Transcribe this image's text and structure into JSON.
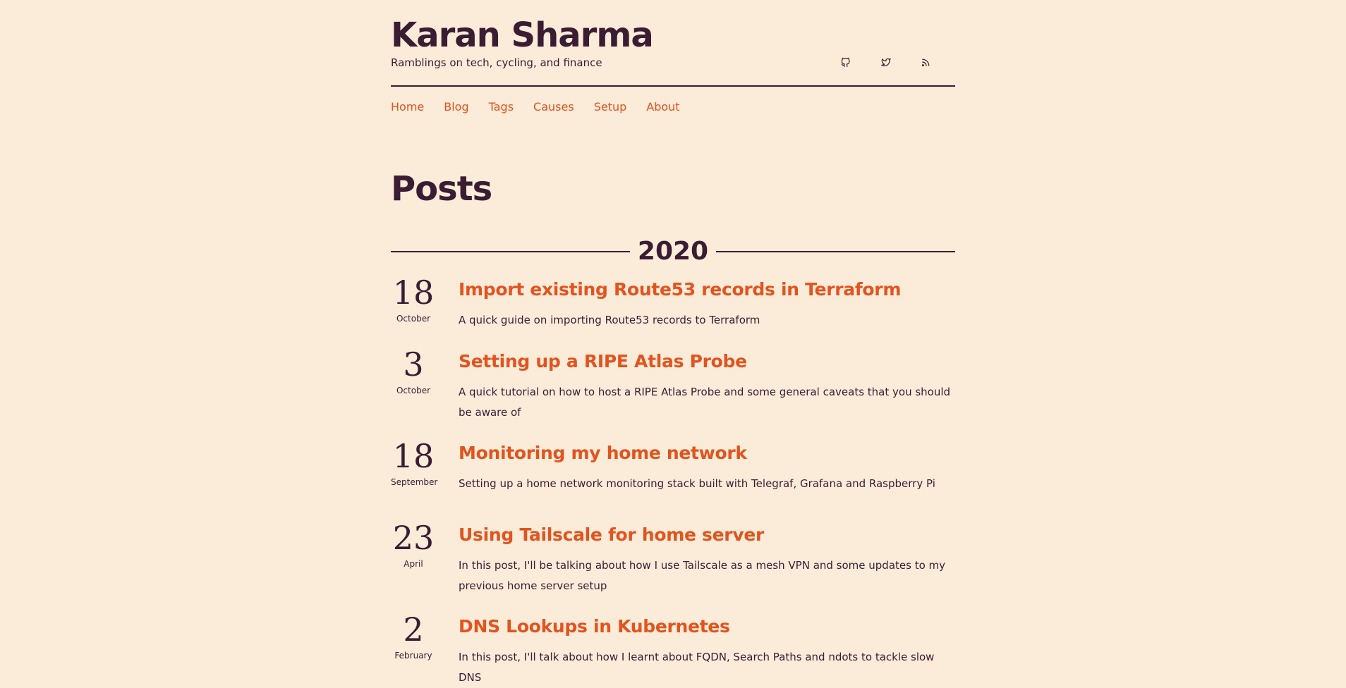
{
  "site": {
    "title": "Karan Sharma",
    "tagline": "Ramblings on tech, cycling, and finance"
  },
  "social": [
    {
      "name": "github-icon"
    },
    {
      "name": "twitter-icon"
    },
    {
      "name": "rss-icon"
    }
  ],
  "nav": [
    "Home",
    "Blog",
    "Tags",
    "Causes",
    "Setup",
    "About"
  ],
  "page_title": "Posts",
  "year": "2020",
  "posts": [
    {
      "day": "18",
      "month": "October",
      "title": "Import existing Route53 records in Terraform",
      "desc": "A quick guide on importing Route53 records to Terraform"
    },
    {
      "day": "3",
      "month": "October",
      "title": "Setting up a RIPE Atlas Probe",
      "desc": "A quick tutorial on how to host a RIPE Atlas Probe and some general caveats that you should be aware of"
    },
    {
      "day": "18",
      "month": "September",
      "title": "Monitoring my home network",
      "desc": "Setting up a home network monitoring stack built with Telegraf, Grafana and Raspberry Pi"
    },
    {
      "day": "23",
      "month": "April",
      "title": "Using Tailscale for home server",
      "desc": "In this post, I'll be talking about how I use Tailscale as a mesh VPN and some updates to my previous home server setup"
    },
    {
      "day": "2",
      "month": "February",
      "title": "DNS Lookups in Kubernetes",
      "desc": "In this post, I'll talk about how I learnt about FQDN, Search Paths and ndots to tackle slow DNS"
    }
  ],
  "colors": {
    "background": "#fbebd9",
    "text": "#3a1c33",
    "accent": "#e1541f"
  }
}
